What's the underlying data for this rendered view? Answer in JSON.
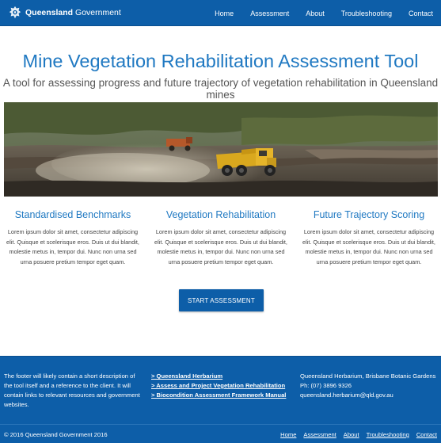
{
  "header": {
    "brand_name": "Queensland",
    "brand_suffix": "Government",
    "nav": [
      "Home",
      "Assessment",
      "About",
      "Troubleshooting",
      "Contact"
    ]
  },
  "hero": {
    "title": "Mine Vegetation Rehabilitation Assessment Tool",
    "subtitle": "A tool for assessing progress and future trajectory of vegetation rehabilitation in Queensland mines"
  },
  "features": [
    {
      "title": "Standardised Benchmarks",
      "text": "Lorem ipsum dolor sit amet, consectetur adipiscing elit. Quisque et scelerisque eros. Duis ut dui blandit, molestie metus in, tempor dui. Nunc non urna sed urna posuere pretium tempor eget quam."
    },
    {
      "title": "Vegetation Rehabilitation",
      "text": "Lorem ipsum dolor sit amet, consectetur adipiscing elit. Quisque et scelerisque eros. Duis ut dui blandit, molestie metus in, tempor dui. Nunc non urna sed urna posuere pretium tempor eget quam."
    },
    {
      "title": "Future Trajectory Scoring",
      "text": "Lorem ipsum dolor sit amet, consectetur adipiscing elit. Quisque et scelerisque eros. Duis ut dui blandit, molestie metus in, tempor dui. Nunc non urna sed urna posuere pretium tempor eget quam."
    }
  ],
  "cta": {
    "label": "START ASSESSMENT"
  },
  "footer": {
    "description": "The footer will likely contain a short description of the tool itself and a reference to the client. It will contain links to relevant resources and government websites.",
    "links": [
      "> Queensland Herbarium",
      "> Assess and Project Vegetation Rehabilitation",
      "> Biocondition Assessment Framework Manual"
    ],
    "contact": {
      "address": "Queensland Herbarium, Brisbane Botanic Gardens",
      "phone": "Ph: (07) 3896 9326",
      "email": "queensland.herbarium@qld.gov.au"
    },
    "copyright": "© 2016 Queensland Government 2016",
    "nav": [
      "Home",
      "Assessment",
      "About",
      "Troubleshooting",
      "Contact"
    ]
  },
  "colors": {
    "brand_blue": "#0d5ea8",
    "heading_blue": "#2079c2"
  },
  "icons": {
    "crest": "queensland-crest-icon",
    "hero_image": "mine-haul-truck-photo"
  }
}
